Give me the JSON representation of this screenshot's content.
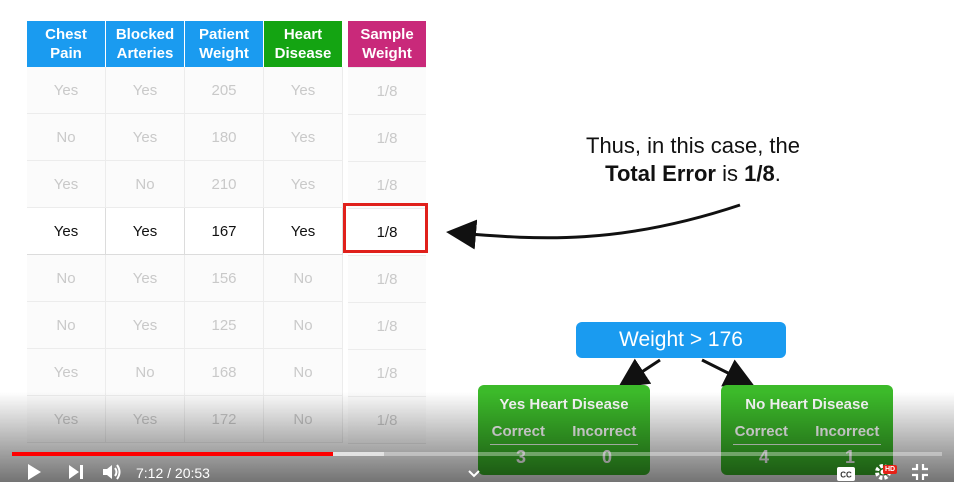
{
  "table": {
    "headers": [
      "Chest Pain",
      "Blocked Arteries",
      "Patient Weight",
      "Heart Disease"
    ],
    "rows": [
      [
        "Yes",
        "Yes",
        "205",
        "Yes"
      ],
      [
        "No",
        "Yes",
        "180",
        "Yes"
      ],
      [
        "Yes",
        "No",
        "210",
        "Yes"
      ],
      [
        "Yes",
        "Yes",
        "167",
        "Yes"
      ],
      [
        "No",
        "Yes",
        "156",
        "No"
      ],
      [
        "No",
        "Yes",
        "125",
        "No"
      ],
      [
        "Yes",
        "No",
        "168",
        "No"
      ],
      [
        "Yes",
        "Yes",
        "172",
        "No"
      ]
    ],
    "highlighted_row": 4
  },
  "sample_weight": {
    "header": "Sample Weight",
    "values": [
      "1/8",
      "1/8",
      "1/8",
      "1/8",
      "1/8",
      "1/8",
      "1/8",
      "1/8"
    ]
  },
  "annotation": {
    "line1": "Thus, in this case, the",
    "bold1": "Total Error",
    "mid": " is ",
    "bold2": "1/8",
    "end": "."
  },
  "stump": {
    "root": "Weight > 176",
    "left": {
      "title": "Yes Heart Disease",
      "correct_label": "Correct",
      "incorrect_label": "Incorrect",
      "correct": "3",
      "incorrect": "0"
    },
    "right": {
      "title": "No Heart Disease",
      "correct_label": "Correct",
      "incorrect_label": "Incorrect",
      "correct": "4",
      "incorrect": "1"
    }
  },
  "colors": {
    "header_blue": "#1a9bf0",
    "header_green": "#14a412",
    "header_magenta": "#c9297a",
    "highlight_red": "#e0201b",
    "leaf_green": "#3cba2a",
    "progress_red": "#ff0000"
  },
  "player": {
    "time": "7:12 / 20:53",
    "progress_fraction": 0.345,
    "buffer_fraction": 0.4,
    "hd_badge": "HD",
    "icons": [
      "play-icon",
      "next-icon",
      "volume-icon",
      "chevron-down-icon",
      "captions-icon",
      "settings-icon",
      "exit-fullscreen-icon"
    ]
  }
}
